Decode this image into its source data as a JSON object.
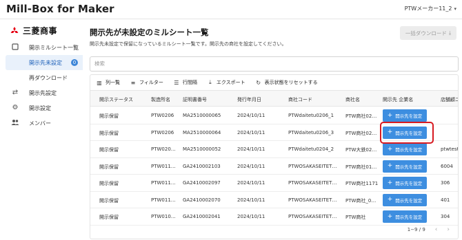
{
  "app": {
    "title": "Mill-Box for Maker",
    "user": "PTWメーカー11_2"
  },
  "brand": {
    "name": "三菱商事",
    "color": "#e60012"
  },
  "sidebar": {
    "items": [
      {
        "label": "開示ミルシート一覧",
        "icon": "tablet-icon"
      },
      {
        "label": "開示先未設定",
        "badge": "0",
        "active": true
      },
      {
        "label": "再ダウンロード"
      },
      {
        "label": "開示先設定",
        "icon": "swap-icon"
      },
      {
        "label": "開示設定",
        "icon": "gear-icon"
      },
      {
        "label": "メンバー",
        "icon": "people-icon"
      }
    ]
  },
  "main": {
    "title": "開示先が未設定のミルシート一覧",
    "description": "開示先未設定で保留になっているミルシート一覧です。開示先の商社を設定してください。",
    "download_button": "一括ダウンロード",
    "search_placeholder": "検索",
    "toolbar": {
      "columns": "列一覧",
      "filter": "フィルター",
      "density": "行間隔",
      "export": "エクスポート",
      "reset": "表示状態をリセットする"
    },
    "table": {
      "headers": [
        "開示ステータス",
        "製造所名",
        "証明書番号",
        "発行年月日",
        "商社コード",
        "商社名",
        "開示先 企業名",
        "店舗顧ニ"
      ],
      "set_button_label": "開示先を設定",
      "rows": [
        {
          "status": "開示保留",
          "maker": "PTW0206",
          "cert": "MA2510000065",
          "date": "2024/10/11",
          "code": "PTWdaitetu0206_1",
          "trader": "PTW商社02…",
          "shop": ""
        },
        {
          "status": "開示保留",
          "maker": "PTW0206",
          "cert": "MA2510000064",
          "date": "2024/10/11",
          "code": "PTWdaitetu0206_3",
          "trader": "PTW商社02…",
          "shop": ""
        },
        {
          "status": "開示保留",
          "maker": "PTW020…",
          "cert": "MA2510000052",
          "date": "2024/10/11",
          "code": "PTWdaitetu0204_2",
          "trader": "PTW大鉄02…",
          "shop": "ptwtest"
        },
        {
          "status": "開示保留",
          "maker": "PTW011…",
          "cert": "GA2410002103",
          "date": "2024/10/11",
          "code": "PTWOSAKASEITET…",
          "trader": "PTW商社01…",
          "shop": "6004"
        },
        {
          "status": "開示保留",
          "maker": "PTW011…",
          "cert": "GA2410002097",
          "date": "2024/10/11",
          "code": "PTWOSAKASEITET…",
          "trader": "PTW商社1171",
          "shop": "306"
        },
        {
          "status": "開示保留",
          "maker": "PTW011…",
          "cert": "GA2410002070",
          "date": "2024/10/11",
          "code": "PTWOSAKASEITET…",
          "trader": "PTW商社_0…",
          "shop": "401"
        },
        {
          "status": "開示保留",
          "maker": "PTW010…",
          "cert": "GA2410002041",
          "date": "2024/10/11",
          "code": "PTWOSAKASEITET…",
          "trader": "PTW商社",
          "shop": "304"
        }
      ]
    },
    "pagination": {
      "range": "1−9 / 9"
    }
  },
  "colors": {
    "accent": "#3d8ee0",
    "highlight": "#d71920",
    "active_nav_bg": "#e9f1fb"
  }
}
